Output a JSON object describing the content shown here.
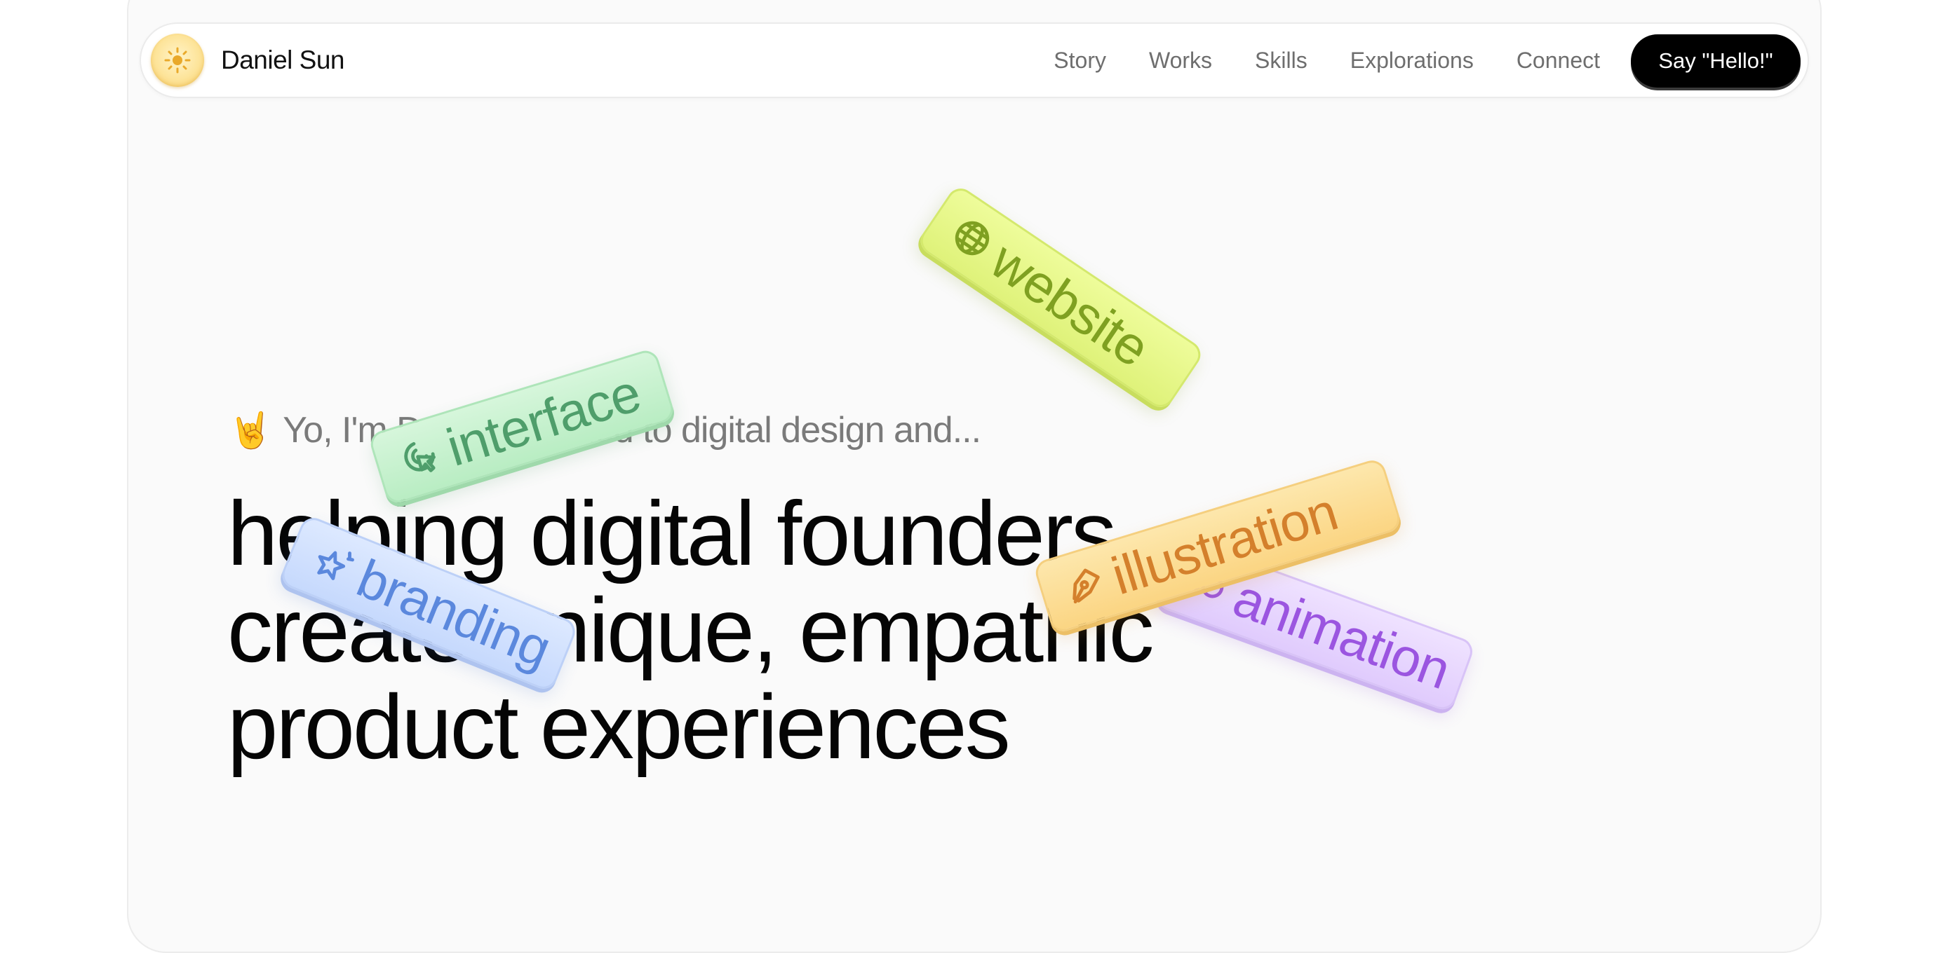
{
  "brand": {
    "name": "Daniel Sun",
    "logo_icon": "sun-icon",
    "logo_color": "#f3c65d"
  },
  "nav": {
    "links": [
      "Story",
      "Works",
      "Skills",
      "Explorations",
      "Connect"
    ],
    "cta_label": "Say \"Hello!\""
  },
  "hero": {
    "intro_emoji": "🤘",
    "intro_text": "Yo, I'm Daniel, married to digital design and...",
    "headline": [
      "helping digital founders",
      "create unique, empathic",
      "product experiences"
    ]
  },
  "tags": [
    {
      "label": "website",
      "icon": "globe-icon",
      "color": "#7fa021"
    },
    {
      "label": "interface",
      "icon": "cursor-click-icon",
      "color": "#4f9e6b"
    },
    {
      "label": "branding",
      "icon": "sparkle-star-icon",
      "color": "#5b88dd"
    },
    {
      "label": "animation",
      "icon": "motion-icon",
      "color": "#9b55e0"
    },
    {
      "label": "illustration",
      "icon": "pen-nib-icon",
      "color": "#d4802c"
    }
  ]
}
